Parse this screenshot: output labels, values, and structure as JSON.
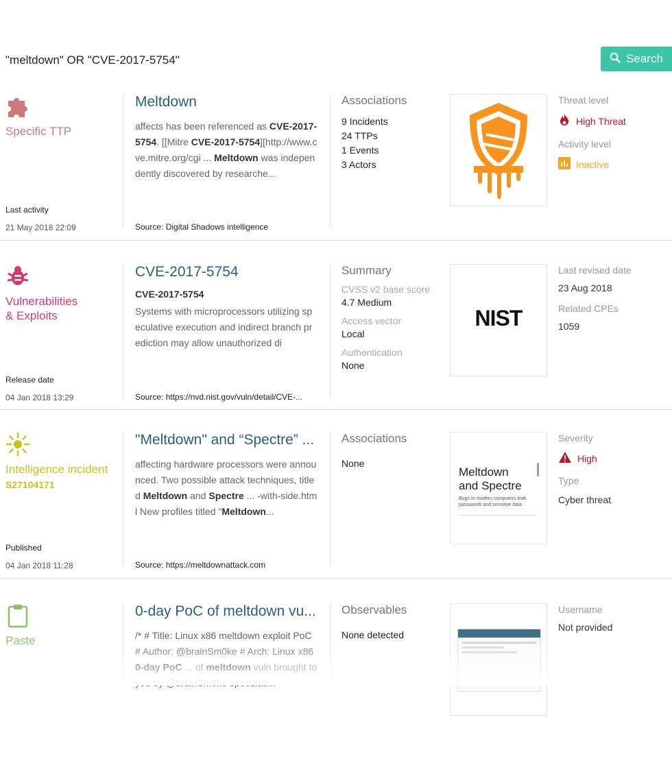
{
  "search": {
    "query": "\"meltdown\" OR \"CVE-2017-5754\"",
    "button_label": "Search"
  },
  "colors": {
    "accent": "#3cc6a8",
    "ttp": "#c97b7b",
    "vuln": "#d23a6e",
    "incident": "#c9c41c",
    "paste": "#8dbf6a",
    "threat_red": "#c0132b",
    "inactive": "#f4a620"
  },
  "results": [
    {
      "type_label": "Specific TTP",
      "date_label": "Last activity",
      "date": "21 May 2018 22:09",
      "title": "Meltdown",
      "snippet_parts": [
        {
          "text": "affects has been referenced as ",
          "b": false
        },
        {
          "text": "CVE-2017-5754",
          "b": true
        },
        {
          "text": ". [[Mitre ",
          "b": false
        },
        {
          "text": "CVE-2017-5754",
          "b": true
        },
        {
          "text": "][http://www.cve.mitre.org/cgi ... ",
          "b": false
        },
        {
          "text": "Meltdown",
          "b": true
        },
        {
          "text": " was independently discovered by researche...",
          "b": false
        }
      ],
      "source": "Source: Digital Shadows intelligence",
      "section_title": "Associations",
      "associations": [
        "9 Incidents",
        "24 TTPs",
        "1 Events",
        "3 Actors"
      ],
      "threat_level_label": "Threat level",
      "threat_level": "High Threat",
      "activity_level_label": "Activity level",
      "activity_level": "Inactive"
    },
    {
      "type_label_line1": "Vulnerabilities",
      "type_label_line2": "& Exploits",
      "date_label": "Release date",
      "date": "04 Jan 2018 13:29",
      "title": "CVE-2017-5754",
      "subtitle": "CVE-2017-5754",
      "snippet": "Systems with microprocessors utilizing speculative execution and indirect branch prediction may allow unauthorized di",
      "source": "Source: https://nvd.nist.gov/vuln/detail/CVE-...",
      "section_title": "Summary",
      "summary": [
        {
          "label": "CVSS v2 base score",
          "value": "4.7 Medium"
        },
        {
          "label": "Access vector",
          "value": "Local"
        },
        {
          "label": "Authentication",
          "value": "None"
        }
      ],
      "thumb_logo": "NIST",
      "last_revised_label": "Last revised date",
      "last_revised": "23 Aug 2018",
      "related_cpes_label": "Related CPEs",
      "related_cpes": "1059"
    },
    {
      "type_label": "Intelligence incident",
      "incident_id": "S27104171",
      "date_label": "Published",
      "date": "04 Jan 2018 11:28",
      "title": "\"Meltdown\" and “Spectre” ...",
      "snippet_parts": [
        {
          "text": "affecting hardware processors were announced. Two possible attack techniques, titled ",
          "b": false
        },
        {
          "text": "Meltdown",
          "b": true
        },
        {
          "text": " and ",
          "b": false
        },
        {
          "text": "Spectre",
          "b": true
        },
        {
          "text": " ... -with-side.html New profiles titled \"",
          "b": false
        },
        {
          "text": "Meltdown",
          "b": true
        },
        {
          "text": "...",
          "b": false
        }
      ],
      "source": "Source: https://meltdownattack.com",
      "section_title": "Associations",
      "associations": [
        "None"
      ],
      "thumb_title_line1": "Meltdown",
      "thumb_title_line2": "and Spectre",
      "thumb_subtitle": "Bugs in modern computers leak passwords and sensitive data.",
      "severity_label": "Severity",
      "severity": "High",
      "type_label_right": "Type",
      "type_value": "Cyber threat"
    },
    {
      "type_label": "Paste",
      "title": "0-day PoC of meltdown vu...",
      "snippet_parts": [
        {
          "text": "/* # Title: Linux x86 meltdown exploit PoC # Author: @brainSm0ke # Arch: Linux x86 ",
          "b": false
        },
        {
          "text": "0-day PoC",
          "b": true
        },
        {
          "text": " ... of ",
          "b": false
        },
        {
          "text": "meltdown",
          "b": true
        },
        {
          "text": " vuln brought to you by @brainSm0ke speculati...",
          "b": false
        }
      ],
      "section_title": "Observables",
      "observables": "None detected",
      "username_label": "Username",
      "username": "Not provided"
    }
  ]
}
